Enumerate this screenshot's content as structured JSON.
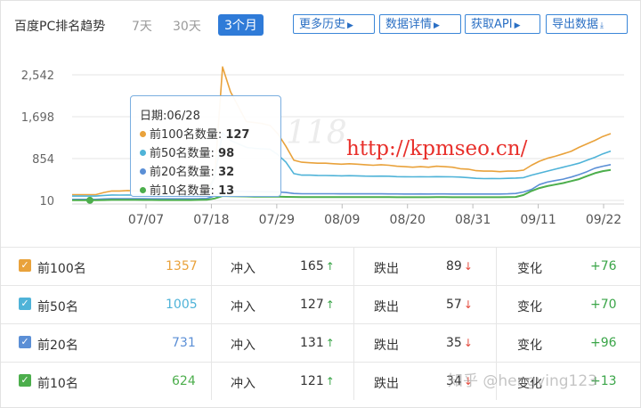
{
  "header": {
    "title": "百度PC排名趋势",
    "periods": [
      "7天",
      "30天",
      "3个月"
    ],
    "active_period": "3个月",
    "buttons": [
      "更多历史",
      "数据详情",
      "获取API",
      "导出数据"
    ]
  },
  "chart_data": {
    "type": "line",
    "y_ticks": [
      "2,542",
      "1,698",
      "854",
      "10"
    ],
    "ylim": [
      10,
      2542
    ],
    "x_ticks": [
      "07/07",
      "07/18",
      "07/29",
      "08/09",
      "08/20",
      "08/31",
      "09/11",
      "09/22"
    ],
    "grid": true,
    "series": [
      {
        "name": "前100名数量",
        "color": "#e9a23b",
        "values": [
          127,
          127,
          127,
          127,
          170,
          200,
          200,
          210,
          200,
          190,
          185,
          180,
          180,
          180,
          180,
          180,
          190,
          210,
          480,
          2700,
          2200,
          1900,
          1600,
          1580,
          1560,
          1520,
          1350,
          1100,
          820,
          780,
          770,
          760,
          760,
          750,
          740,
          750,
          740,
          730,
          720,
          730,
          720,
          700,
          690,
          680,
          690,
          680,
          700,
          690,
          680,
          650,
          640,
          610,
          600,
          600,
          590,
          600,
          600,
          620,
          720,
          800,
          860,
          900,
          950,
          1000,
          1080,
          1150,
          1220,
          1300,
          1357
        ]
      },
      {
        "name": "前50名数量",
        "color": "#4fb3d8",
        "values": [
          98,
          98,
          98,
          98,
          110,
          120,
          118,
          120,
          118,
          115,
          112,
          110,
          110,
          110,
          110,
          110,
          118,
          130,
          480,
          1370,
          1220,
          1150,
          1080,
          1060,
          1050,
          1040,
          930,
          780,
          550,
          520,
          520,
          515,
          512,
          510,
          505,
          510,
          505,
          500,
          498,
          500,
          498,
          490,
          488,
          485,
          488,
          485,
          490,
          488,
          486,
          480,
          470,
          455,
          450,
          452,
          450,
          455,
          460,
          470,
          520,
          560,
          600,
          640,
          680,
          720,
          760,
          820,
          880,
          950,
          1005
        ]
      },
      {
        "name": "前20名数量",
        "color": "#5b8fd6",
        "values": [
          32,
          32,
          32,
          32,
          40,
          45,
          45,
          45,
          45,
          44,
          43,
          42,
          42,
          42,
          42,
          42,
          45,
          50,
          100,
          210,
          200,
          195,
          190,
          188,
          186,
          185,
          180,
          170,
          150,
          145,
          145,
          145,
          144,
          144,
          143,
          143,
          143,
          142,
          142,
          142,
          141,
          141,
          140,
          140,
          141,
          140,
          141,
          141,
          140,
          140,
          140,
          139,
          139,
          140,
          140,
          142,
          150,
          180,
          230,
          330,
          380,
          410,
          440,
          480,
          530,
          590,
          660,
          700,
          731
        ]
      },
      {
        "name": "前10名数量",
        "color": "#4cae4c",
        "values": [
          13,
          13,
          13,
          13,
          18,
          20,
          20,
          20,
          20,
          19,
          19,
          18,
          18,
          18,
          18,
          18,
          20,
          22,
          50,
          100,
          95,
          92,
          90,
          88,
          87,
          86,
          85,
          82,
          80,
          78,
          78,
          78,
          77,
          77,
          77,
          77,
          76,
          76,
          76,
          76,
          76,
          75,
          75,
          75,
          75,
          75,
          76,
          76,
          75,
          75,
          75,
          75,
          75,
          75,
          75,
          76,
          80,
          120,
          200,
          260,
          300,
          330,
          360,
          400,
          440,
          500,
          560,
          600,
          624
        ]
      }
    ]
  },
  "tooltip": {
    "date_label": "日期:06/28",
    "rows": [
      {
        "label": "前100名数量: ",
        "value": "127",
        "color": "#e9a23b"
      },
      {
        "label": "前50名数量: ",
        "value": "98",
        "color": "#4fb3d8"
      },
      {
        "label": "前20名数量: ",
        "value": "32",
        "color": "#5b8fd6"
      },
      {
        "label": "前10名数量: ",
        "value": "13",
        "color": "#4cae4c"
      }
    ]
  },
  "overlay": {
    "url_text": "http://kpmseo.cn/",
    "watermark": "118"
  },
  "table": {
    "rows": [
      {
        "label": "前100名",
        "count": "1357",
        "color": "#e9a23b",
        "in_label": "冲入",
        "in_val": "165",
        "out_label": "跌出",
        "out_val": "89",
        "chg_label": "变化",
        "chg_val": "+76"
      },
      {
        "label": "前50名",
        "count": "1005",
        "color": "#4fb3d8",
        "in_label": "冲入",
        "in_val": "127",
        "out_label": "跌出",
        "out_val": "57",
        "chg_label": "变化",
        "chg_val": "+70"
      },
      {
        "label": "前20名",
        "count": "731",
        "color": "#5b8fd6",
        "in_label": "冲入",
        "in_val": "131",
        "out_label": "跌出",
        "out_val": "35",
        "chg_label": "变化",
        "chg_val": "+96"
      },
      {
        "label": "前10名",
        "count": "624",
        "color": "#4cae4c",
        "in_label": "冲入",
        "in_val": "121",
        "out_label": "跌出",
        "out_val": "34",
        "chg_label": "变化",
        "chg_val": "+13"
      }
    ]
  },
  "footer_watermark": "知乎 @hengying123"
}
